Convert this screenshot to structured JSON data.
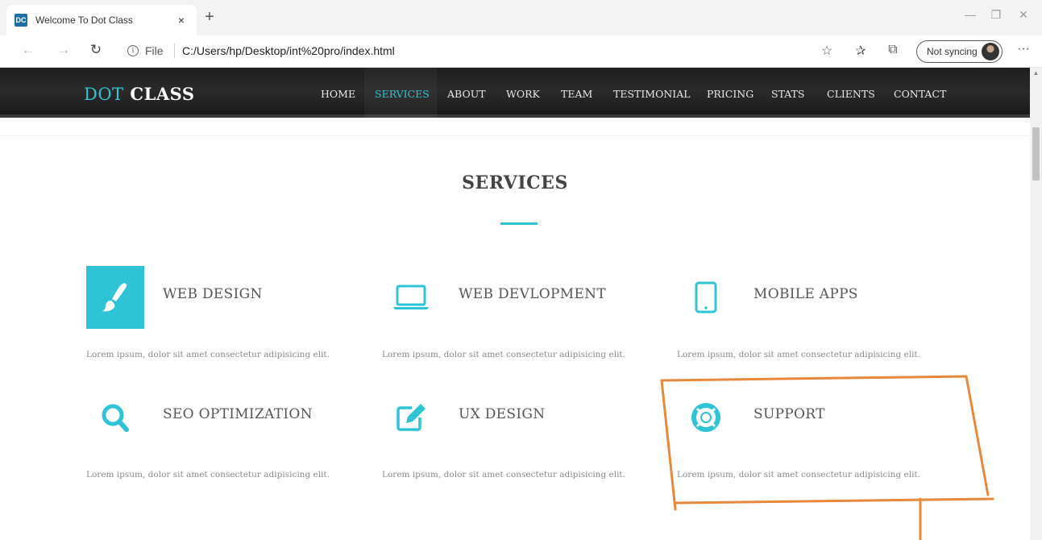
{
  "browser": {
    "tab": {
      "favicon_text": "DC",
      "title": "Welcome To Dot Class",
      "close_glyph": "×"
    },
    "new_tab_glyph": "+",
    "window_controls": {
      "minimize": "—",
      "restore": "❐",
      "close": "✕"
    },
    "nav": {
      "back": "←",
      "forward": "→",
      "refresh": "↻"
    },
    "address": {
      "info_glyph": "i",
      "scheme_label": "File",
      "url": "C:/Users/hp/Desktop/int%20pro/index.html"
    },
    "toolbar": {
      "favorite": "☆",
      "favorites_list": "✰",
      "collections": "⧉",
      "more": "···"
    },
    "profile": {
      "label": "Not syncing"
    }
  },
  "site": {
    "brand": {
      "part1": "DOT",
      "part2": " CLASS"
    },
    "menu": [
      {
        "label": "HOME",
        "active": false
      },
      {
        "label": "SERVICES",
        "active": true
      },
      {
        "label": "ABOUT",
        "active": false
      },
      {
        "label": "WORK",
        "active": false
      },
      {
        "label": "TEAM",
        "active": false
      },
      {
        "label": "TESTIMONIAL",
        "active": false
      },
      {
        "label": "PRICING",
        "active": false
      },
      {
        "label": "STATS",
        "active": false
      },
      {
        "label": "CLIENTS",
        "active": false
      },
      {
        "label": "CONTACT",
        "active": false
      }
    ],
    "accent_color": "#2ec4d6",
    "section": {
      "title": "SERVICES",
      "services": [
        {
          "title": "WEB DESIGN",
          "icon": "paintbrush-icon",
          "desc": "Lorem ipsum, dolor sit amet consectetur adipisicing elit."
        },
        {
          "title": "WEB DEVLOPMENT",
          "icon": "laptop-icon",
          "desc": "Lorem ipsum, dolor sit amet consectetur adipisicing elit."
        },
        {
          "title": "MOBILE APPS",
          "icon": "tablet-icon",
          "desc": "Lorem ipsum, dolor sit amet consectetur adipisicing elit."
        },
        {
          "title": "SEO OPTIMIZATION",
          "icon": "search-icon",
          "desc": "Lorem ipsum, dolor sit amet consectetur adipisicing elit."
        },
        {
          "title": "UX DESIGN",
          "icon": "edit-icon",
          "desc": "Lorem ipsum, dolor sit amet consectetur adipisicing elit."
        },
        {
          "title": "SUPPORT",
          "icon": "life-ring-icon",
          "desc": "Lorem ipsum, dolor sit amet consectetur adipisicing elit."
        }
      ]
    }
  },
  "annotation_color": "#e8883a"
}
